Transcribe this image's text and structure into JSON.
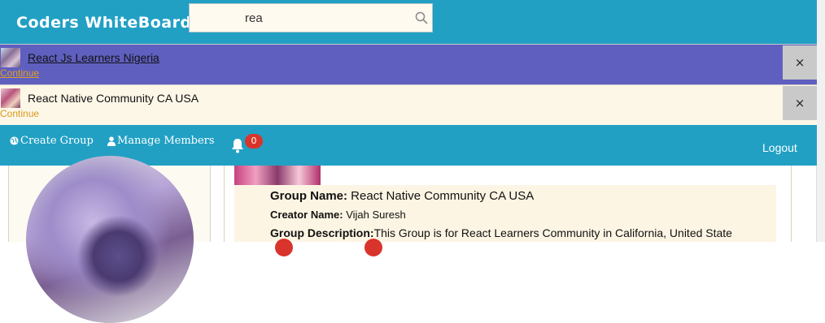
{
  "header": {
    "brand": "Coders WhiteBoard",
    "search": {
      "value": "rea",
      "icon": "search-icon"
    }
  },
  "results": [
    {
      "name": "React Js Learners Nigeria",
      "action": "Continue",
      "close": "×"
    },
    {
      "name": "React Native Community CA USA",
      "action": "Continue",
      "close": "×"
    }
  ],
  "nav": {
    "create_group": "Create Group",
    "manage_members": "Manage Members",
    "notifications_count": "0",
    "logout": "Logout"
  },
  "group": {
    "name_label": "Group Name:",
    "name_value": " React Native Community CA USA",
    "creator_label": "Creator Name:",
    "creator_value": " Vijah Suresh",
    "description_label": "Group Description:",
    "description_value": "This Group is for React Learners Community in California, United State"
  },
  "colors": {
    "header_bg": "#21a0c4",
    "selected_row_bg": "#5f5fc0",
    "row_bg": "#fdf7e8",
    "badge": "#d9342b"
  }
}
